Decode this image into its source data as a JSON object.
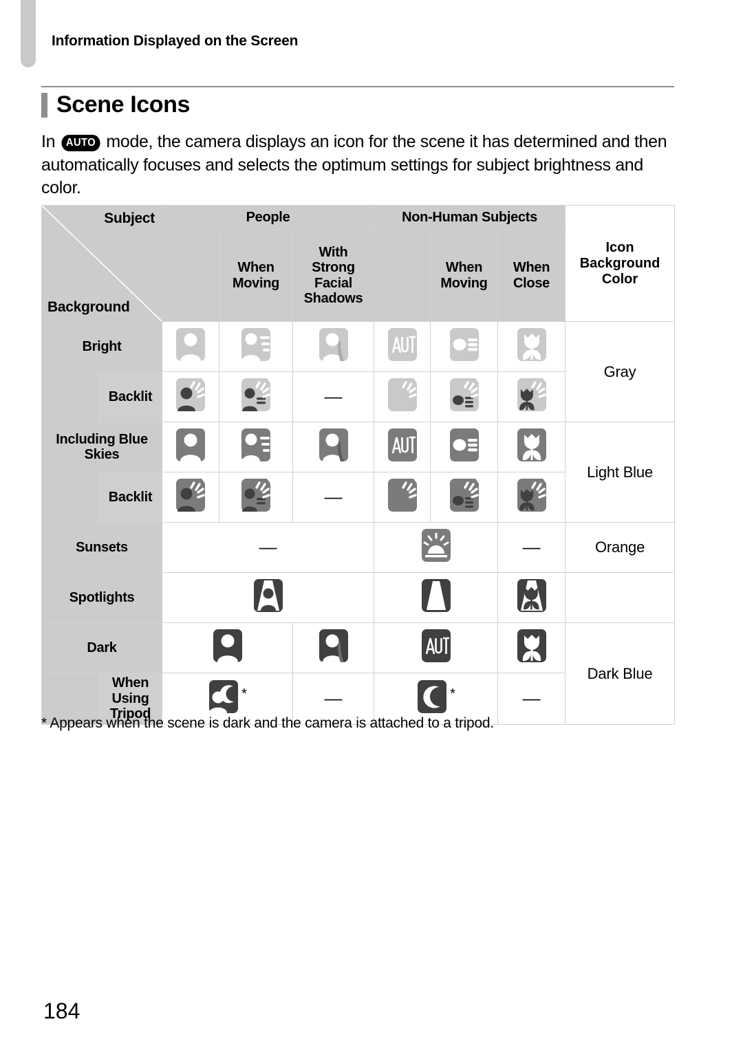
{
  "running_head": "Information Displayed on the Screen",
  "section_title": "Scene Icons",
  "intro": {
    "before": "In",
    "mode_badge": "AUTO",
    "after": "mode, the camera displays an icon for the scene it has determined and then automatically focuses and selects the optimum settings for subject brightness and color."
  },
  "table": {
    "corner": {
      "subject_label": "Subject",
      "background_label": "Background"
    },
    "group_headers": {
      "people": "People",
      "non_human": "Non-Human Subjects",
      "icon_bg_color": "Icon\nBackground\nColor"
    },
    "sub_headers": {
      "people_when_moving": "When\nMoving",
      "people_strong_shadows": "With\nStrong\nFacial\nShadows",
      "nonhuman_when_moving": "When\nMoving",
      "nonhuman_when_close": "When\nClose"
    },
    "rows": [
      {
        "label": "Bright",
        "indent": false,
        "icon_tone": "light",
        "cells": [
          "person",
          "person-moving",
          "person-shadow",
          "auto",
          "object-moving",
          "tulip"
        ],
        "bg_color": "Gray",
        "bg_color_rowspan": 2
      },
      {
        "label": "Backlit",
        "indent": true,
        "icon_tone": "light",
        "cells": [
          "person-backlit",
          "person-moving-backlit",
          "dash",
          "backlit",
          "object-backlit",
          "tulip-backlit"
        ]
      },
      {
        "label": "Including Blue\nSkies",
        "indent": false,
        "icon_tone": "mid",
        "cells": [
          "person",
          "person-moving",
          "person-shadow",
          "auto",
          "object-moving",
          "tulip"
        ],
        "bg_color": "Light Blue",
        "bg_color_rowspan": 2
      },
      {
        "label": "Backlit",
        "indent": true,
        "icon_tone": "mid",
        "cells": [
          "person-backlit",
          "person-moving-backlit",
          "dash",
          "backlit",
          "object-backlit",
          "tulip-backlit"
        ]
      },
      {
        "label": "Sunsets",
        "indent": false,
        "icon_tone": "mid",
        "cells": [
          "dash-wide",
          "sunset",
          "dash"
        ],
        "bg_color": "Orange",
        "bg_color_rowspan": 1
      },
      {
        "label": "Spotlights",
        "indent": false,
        "icon_tone": "dark",
        "cells": [
          "spotlight-person",
          "spotlight",
          "spotlight-tulip"
        ],
        "bg_color": "",
        "bg_color_rowspan": 1
      },
      {
        "label": "Dark",
        "indent": false,
        "icon_tone": "dark",
        "cells": [
          "person",
          "person-shadow",
          "auto",
          "tulip"
        ],
        "bg_color": "Dark Blue",
        "bg_color_rowspan": 2
      },
      {
        "label": "When Using\nTripod",
        "indent": true,
        "icon_tone": "dark",
        "cells": [
          "person-night-star",
          "dash",
          "moon-star",
          "dash"
        ]
      }
    ]
  },
  "footnote": "* Appears when the scene is dark and the camera is attached to a tripod.",
  "page_number": "184",
  "colors": {
    "icon_light": "#c9c9c9",
    "icon_mid": "#7b7b7b",
    "icon_dark": "#404040",
    "header_gray": "#cccccc",
    "rule_gray": "#8d8d8d"
  }
}
